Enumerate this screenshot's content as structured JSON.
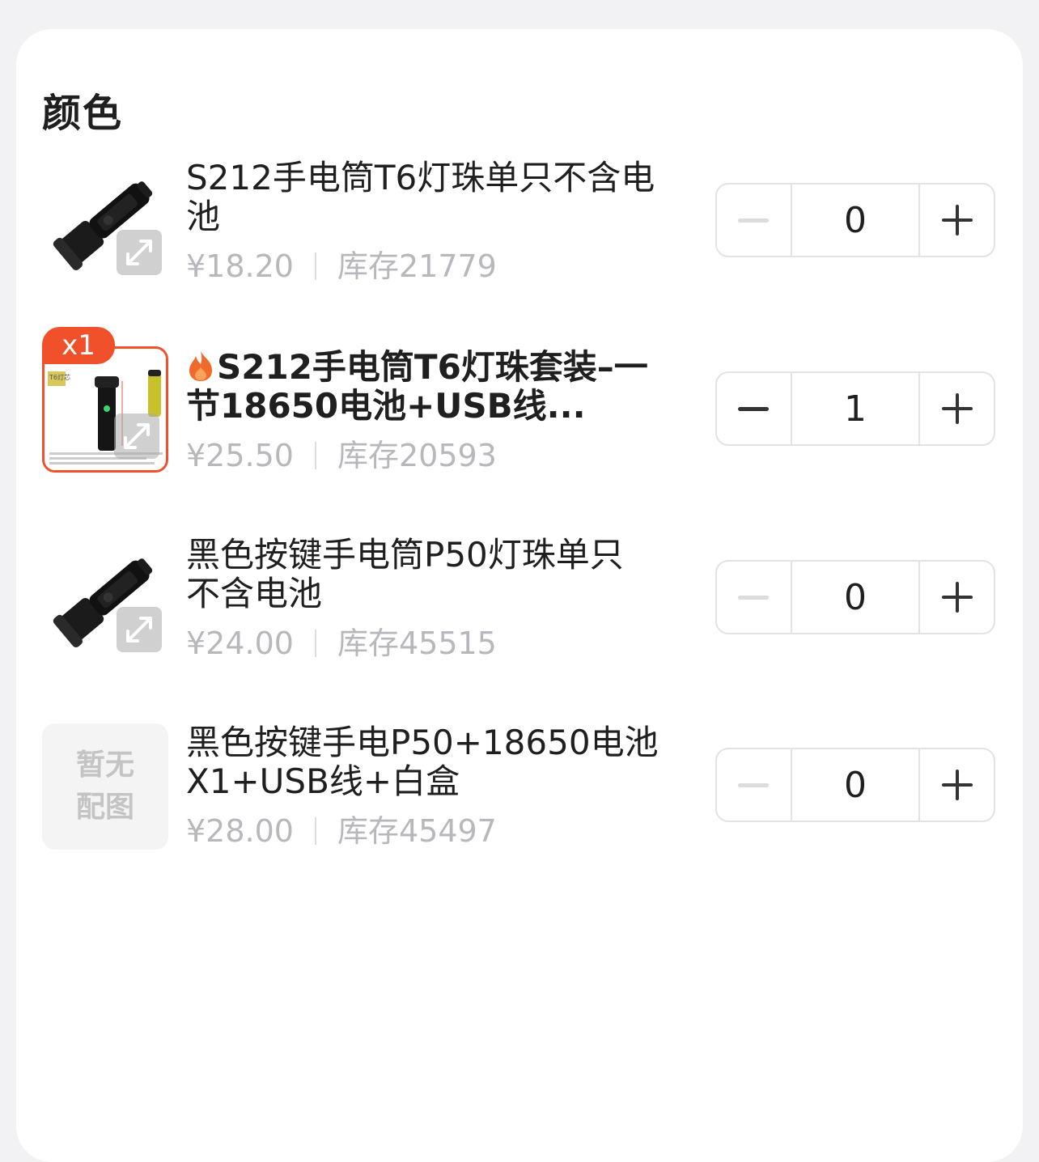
{
  "section": {
    "title": "颜色"
  },
  "colors": {
    "accent": "#f0512b",
    "muted_text": "#b8b8bc"
  },
  "items": [
    {
      "name": "S212手电筒T6灯珠单只不含电池",
      "price": "¥18.20",
      "stock": "库存21779",
      "quantity": "0",
      "thumb_icon": "flashlight-image"
    },
    {
      "name": "S212手电筒T6灯珠套装–一节18650电池+USB线...",
      "price": "¥25.50",
      "stock": "库存20593",
      "quantity": "1",
      "badge": "x1",
      "hot_icon": "fire-icon",
      "thumb_icon": "flashlight-kit-image",
      "thumb_label": "T6灯芯"
    },
    {
      "name": "黑色按键手电筒P50灯珠单只不含电池",
      "price": "¥24.00",
      "stock": "库存45515",
      "quantity": "0",
      "thumb_icon": "flashlight-image"
    },
    {
      "name": "黑色按键手电P50+18650电池X1+USB线+白盒",
      "price": "¥28.00",
      "stock": "库存45497",
      "quantity": "0",
      "placeholder_line1": "暂无",
      "placeholder_line2": "配图"
    }
  ]
}
